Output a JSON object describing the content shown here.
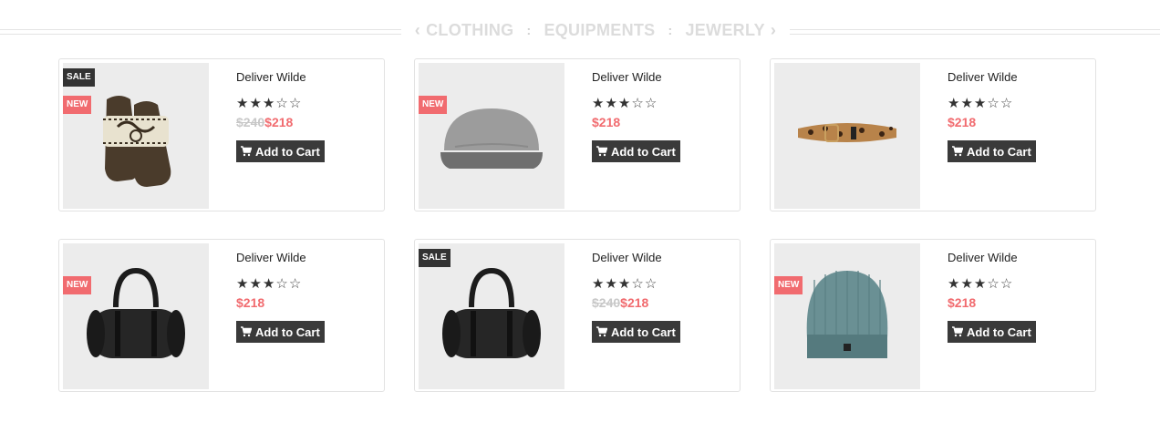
{
  "category_nav": {
    "prev": "‹",
    "next": "›",
    "tabs": [
      "CLOTHING",
      "EQUIPMENTS",
      "JEWERLY"
    ],
    "separator": ":"
  },
  "products": [
    {
      "name": "Deliver Wilde",
      "rating": 3,
      "max_rating": 5,
      "old_price": "$240",
      "price": "$218",
      "badges": [
        "SALE",
        "NEW"
      ],
      "image": "mittens",
      "cart_label": "Add to Cart"
    },
    {
      "name": "Deliver Wilde",
      "rating": 3,
      "max_rating": 5,
      "old_price": "",
      "price": "$218",
      "badges": [
        "NEW"
      ],
      "image": "cap",
      "cart_label": "Add to Cart"
    },
    {
      "name": "Deliver Wilde",
      "rating": 3,
      "max_rating": 5,
      "old_price": "",
      "price": "$218",
      "badges": [],
      "image": "belt",
      "cart_label": "Add to Cart"
    },
    {
      "name": "Deliver Wilde",
      "rating": 3,
      "max_rating": 5,
      "old_price": "",
      "price": "$218",
      "badges": [
        "NEW"
      ],
      "image": "duffel-bag",
      "cart_label": "Add to Cart"
    },
    {
      "name": "Deliver Wilde",
      "rating": 3,
      "max_rating": 5,
      "old_price": "$240",
      "price": "$218",
      "badges": [
        "SALE"
      ],
      "image": "duffel-bag",
      "cart_label": "Add to Cart"
    },
    {
      "name": "Deliver Wilde",
      "rating": 3,
      "max_rating": 5,
      "old_price": "",
      "price": "$218",
      "badges": [
        "NEW"
      ],
      "image": "beanie",
      "cart_label": "Add to Cart"
    }
  ],
  "colors": {
    "accent": "#f16b6f",
    "button": "#3a3a3a",
    "sale_badge": "#333333",
    "thumb_bg": "#ececec"
  }
}
